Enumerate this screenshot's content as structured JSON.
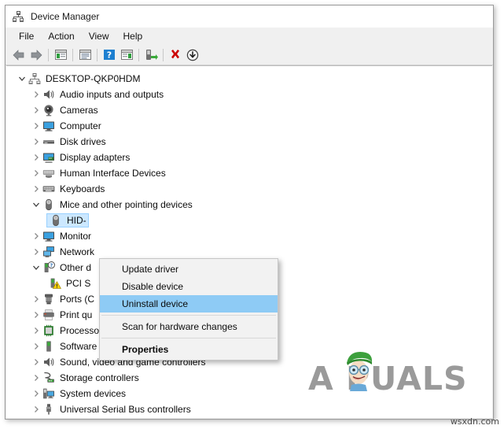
{
  "window": {
    "title": "Device Manager",
    "icon": "device-manager-icon"
  },
  "menubar": {
    "items": [
      {
        "label": "File"
      },
      {
        "label": "Action"
      },
      {
        "label": "View"
      },
      {
        "label": "Help"
      }
    ]
  },
  "toolbar": {
    "buttons": [
      {
        "name": "back-icon",
        "tooltip": "Back"
      },
      {
        "name": "forward-icon",
        "tooltip": "Forward"
      },
      {
        "name": "separator-1",
        "tooltip": ""
      },
      {
        "name": "show-hide-console-tree-icon",
        "tooltip": "Show/Hide Console Tree"
      },
      {
        "name": "separator-2",
        "tooltip": ""
      },
      {
        "name": "properties-icon",
        "tooltip": "Properties"
      },
      {
        "name": "separator-3",
        "tooltip": ""
      },
      {
        "name": "help-icon",
        "tooltip": "Help"
      },
      {
        "name": "show-hide-action-pane-icon",
        "tooltip": "Show/Hide Action Pane"
      },
      {
        "name": "separator-4",
        "tooltip": ""
      },
      {
        "name": "scan-for-hardware-changes-icon",
        "tooltip": "Scan for hardware changes"
      },
      {
        "name": "separator-5",
        "tooltip": ""
      },
      {
        "name": "update-driver-icon",
        "tooltip": "Update driver"
      },
      {
        "name": "uninstall-device-icon",
        "tooltip": "Uninstall device"
      },
      {
        "name": "disable-device-icon",
        "tooltip": "Disable device"
      }
    ]
  },
  "tree": {
    "nodes": [
      {
        "label": "DESKTOP-QKP0HDM",
        "level": 0,
        "state": "expanded",
        "icon": "computer-root-icon",
        "selected": false
      },
      {
        "label": "Audio inputs and outputs",
        "level": 1,
        "state": "collapsed",
        "icon": "speaker-icon",
        "selected": false
      },
      {
        "label": "Cameras",
        "level": 1,
        "state": "collapsed",
        "icon": "camera-icon",
        "selected": false
      },
      {
        "label": "Computer",
        "level": 1,
        "state": "collapsed",
        "icon": "monitor-icon",
        "selected": false
      },
      {
        "label": "Disk drives",
        "level": 1,
        "state": "collapsed",
        "icon": "disk-drive-icon",
        "selected": false
      },
      {
        "label": "Display adapters",
        "level": 1,
        "state": "collapsed",
        "icon": "display-adapter-icon",
        "selected": false
      },
      {
        "label": "Human Interface Devices",
        "level": 1,
        "state": "collapsed",
        "icon": "hid-icon",
        "selected": false
      },
      {
        "label": "Keyboards",
        "level": 1,
        "state": "collapsed",
        "icon": "keyboard-icon",
        "selected": false
      },
      {
        "label": "Mice and other pointing devices",
        "level": 1,
        "state": "expanded",
        "icon": "mouse-icon",
        "selected": false
      },
      {
        "label": "HID-",
        "level": 2,
        "state": "leaf",
        "icon": "mouse-icon",
        "selected": true
      },
      {
        "label": "Monitor",
        "level": 1,
        "state": "collapsed",
        "icon": "monitor-icon",
        "selected": false
      },
      {
        "label": "Network",
        "level": 1,
        "state": "collapsed",
        "icon": "network-adapter-icon",
        "selected": false
      },
      {
        "label": "Other d",
        "level": 1,
        "state": "expanded",
        "icon": "other-devices-icon",
        "selected": false
      },
      {
        "label": "PCI S",
        "level": 2,
        "state": "leaf",
        "icon": "unknown-device-warning-icon",
        "selected": false
      },
      {
        "label": "Ports (C",
        "level": 1,
        "state": "collapsed",
        "icon": "port-icon",
        "selected": false
      },
      {
        "label": "Print qu",
        "level": 1,
        "state": "collapsed",
        "icon": "printer-icon",
        "selected": false
      },
      {
        "label": "Processors",
        "level": 1,
        "state": "collapsed",
        "icon": "processor-icon",
        "selected": false
      },
      {
        "label": "Software devices",
        "level": 1,
        "state": "collapsed",
        "icon": "software-device-icon",
        "selected": false
      },
      {
        "label": "Sound, video and game controllers",
        "level": 1,
        "state": "collapsed",
        "icon": "speaker-icon",
        "selected": false
      },
      {
        "label": "Storage controllers",
        "level": 1,
        "state": "collapsed",
        "icon": "storage-controller-icon",
        "selected": false
      },
      {
        "label": "System devices",
        "level": 1,
        "state": "collapsed",
        "icon": "system-device-icon",
        "selected": false
      },
      {
        "label": "Universal Serial Bus controllers",
        "level": 1,
        "state": "collapsed",
        "icon": "usb-controller-icon",
        "selected": false
      }
    ]
  },
  "context_menu": {
    "items": [
      {
        "label": "Update driver",
        "type": "item",
        "highlighted": false,
        "bold": false
      },
      {
        "label": "Disable device",
        "type": "item",
        "highlighted": false,
        "bold": false
      },
      {
        "label": "Uninstall device",
        "type": "item",
        "highlighted": true,
        "bold": false
      },
      {
        "label": "",
        "type": "separator",
        "highlighted": false,
        "bold": false
      },
      {
        "label": "Scan for hardware changes",
        "type": "item",
        "highlighted": false,
        "bold": false
      },
      {
        "label": "",
        "type": "separator",
        "highlighted": false,
        "bold": false
      },
      {
        "label": "Properties",
        "type": "item",
        "highlighted": false,
        "bold": true
      }
    ]
  },
  "watermarks": {
    "logo_text": "A PUALS",
    "site_text": "wsxdn.com"
  },
  "colors": {
    "selection_blue": "#cce8ff",
    "menu_highlight_blue": "#8ecbf5",
    "window_chrome": "#f0f0f0",
    "content_bg": "#ffffff",
    "error_red": "#cc0000",
    "warning_yellow": "#ffd100"
  }
}
